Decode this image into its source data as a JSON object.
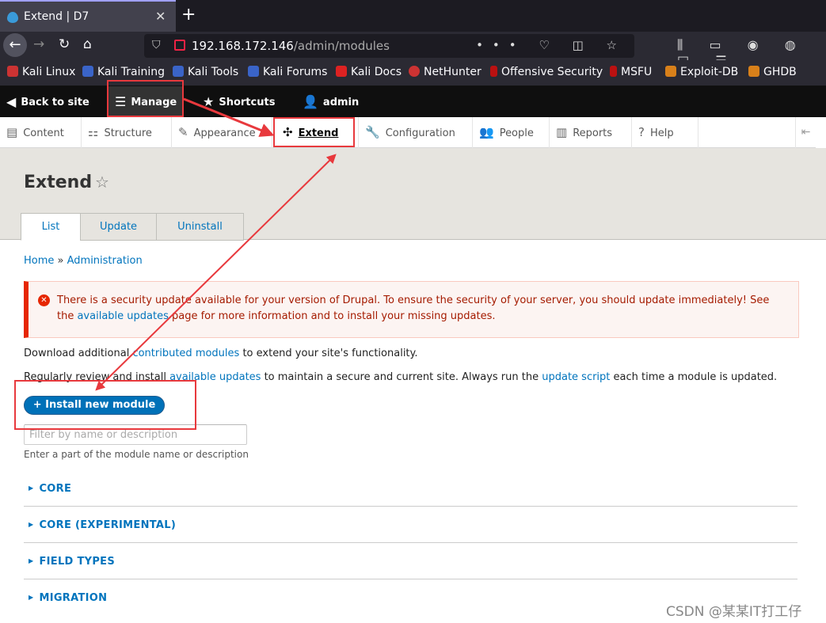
{
  "browser": {
    "tab_title": "Extend | D7",
    "close_tab_glyph": "✕",
    "new_tab_glyph": "+",
    "url_host": "192.168.172.146",
    "url_path": "/admin/modules",
    "url_actions": "••• ♡ ◫ ☆",
    "toolbar_icons": "⫼ ▭ ◉ ◍ ◱ ☰",
    "bookmarks": [
      "Kali Linux",
      "Kali Training",
      "Kali Tools",
      "Kali Forums",
      "Kali Docs",
      "NetHunter",
      "Offensive Security",
      "MSFU",
      "Exploit-DB",
      "GHDB"
    ]
  },
  "drupal_toolbar": {
    "back_to_site": "Back to site",
    "manage": "Manage",
    "shortcuts": "Shortcuts",
    "user": "admin"
  },
  "admin_tray": {
    "items": [
      "Content",
      "Structure",
      "Appearance",
      "Extend",
      "Configuration",
      "People",
      "Reports",
      "Help"
    ],
    "active": "Extend"
  },
  "page": {
    "title": "Extend",
    "tabs": [
      "List",
      "Update",
      "Uninstall"
    ],
    "active_tab": "List",
    "breadcrumb": {
      "home": "Home",
      "separator": " » ",
      "admin": "Administration"
    },
    "error_message": {
      "before": "There is a security update available for your version of Drupal. To ensure the security of your server, you should update immediately! See the ",
      "link": "available updates",
      "after": " page for more information and to install your missing updates."
    },
    "download_text": {
      "before": "Download additional ",
      "link": "contributed modules",
      "after": " to extend your site's functionality."
    },
    "review_text": {
      "before": "Regularly review and install ",
      "link1": "available updates",
      "middle": " to maintain a secure and current site. Always run the ",
      "link2": "update script",
      "after": " each time a module is updated."
    },
    "install_button": "+ Install new module",
    "filter_placeholder": "Filter by name or description",
    "filter_description": "Enter a part of the module name or description",
    "module_groups": [
      "CORE",
      "CORE (EXPERIMENTAL)",
      "FIELD TYPES",
      "MIGRATION"
    ]
  },
  "watermark": "CSDN @某某IT打工仔",
  "colors": {
    "link": "#0074bd",
    "error_red": "#e62600",
    "annotation_red": "#e8393d",
    "toolbar_black": "#0f0f0f"
  }
}
